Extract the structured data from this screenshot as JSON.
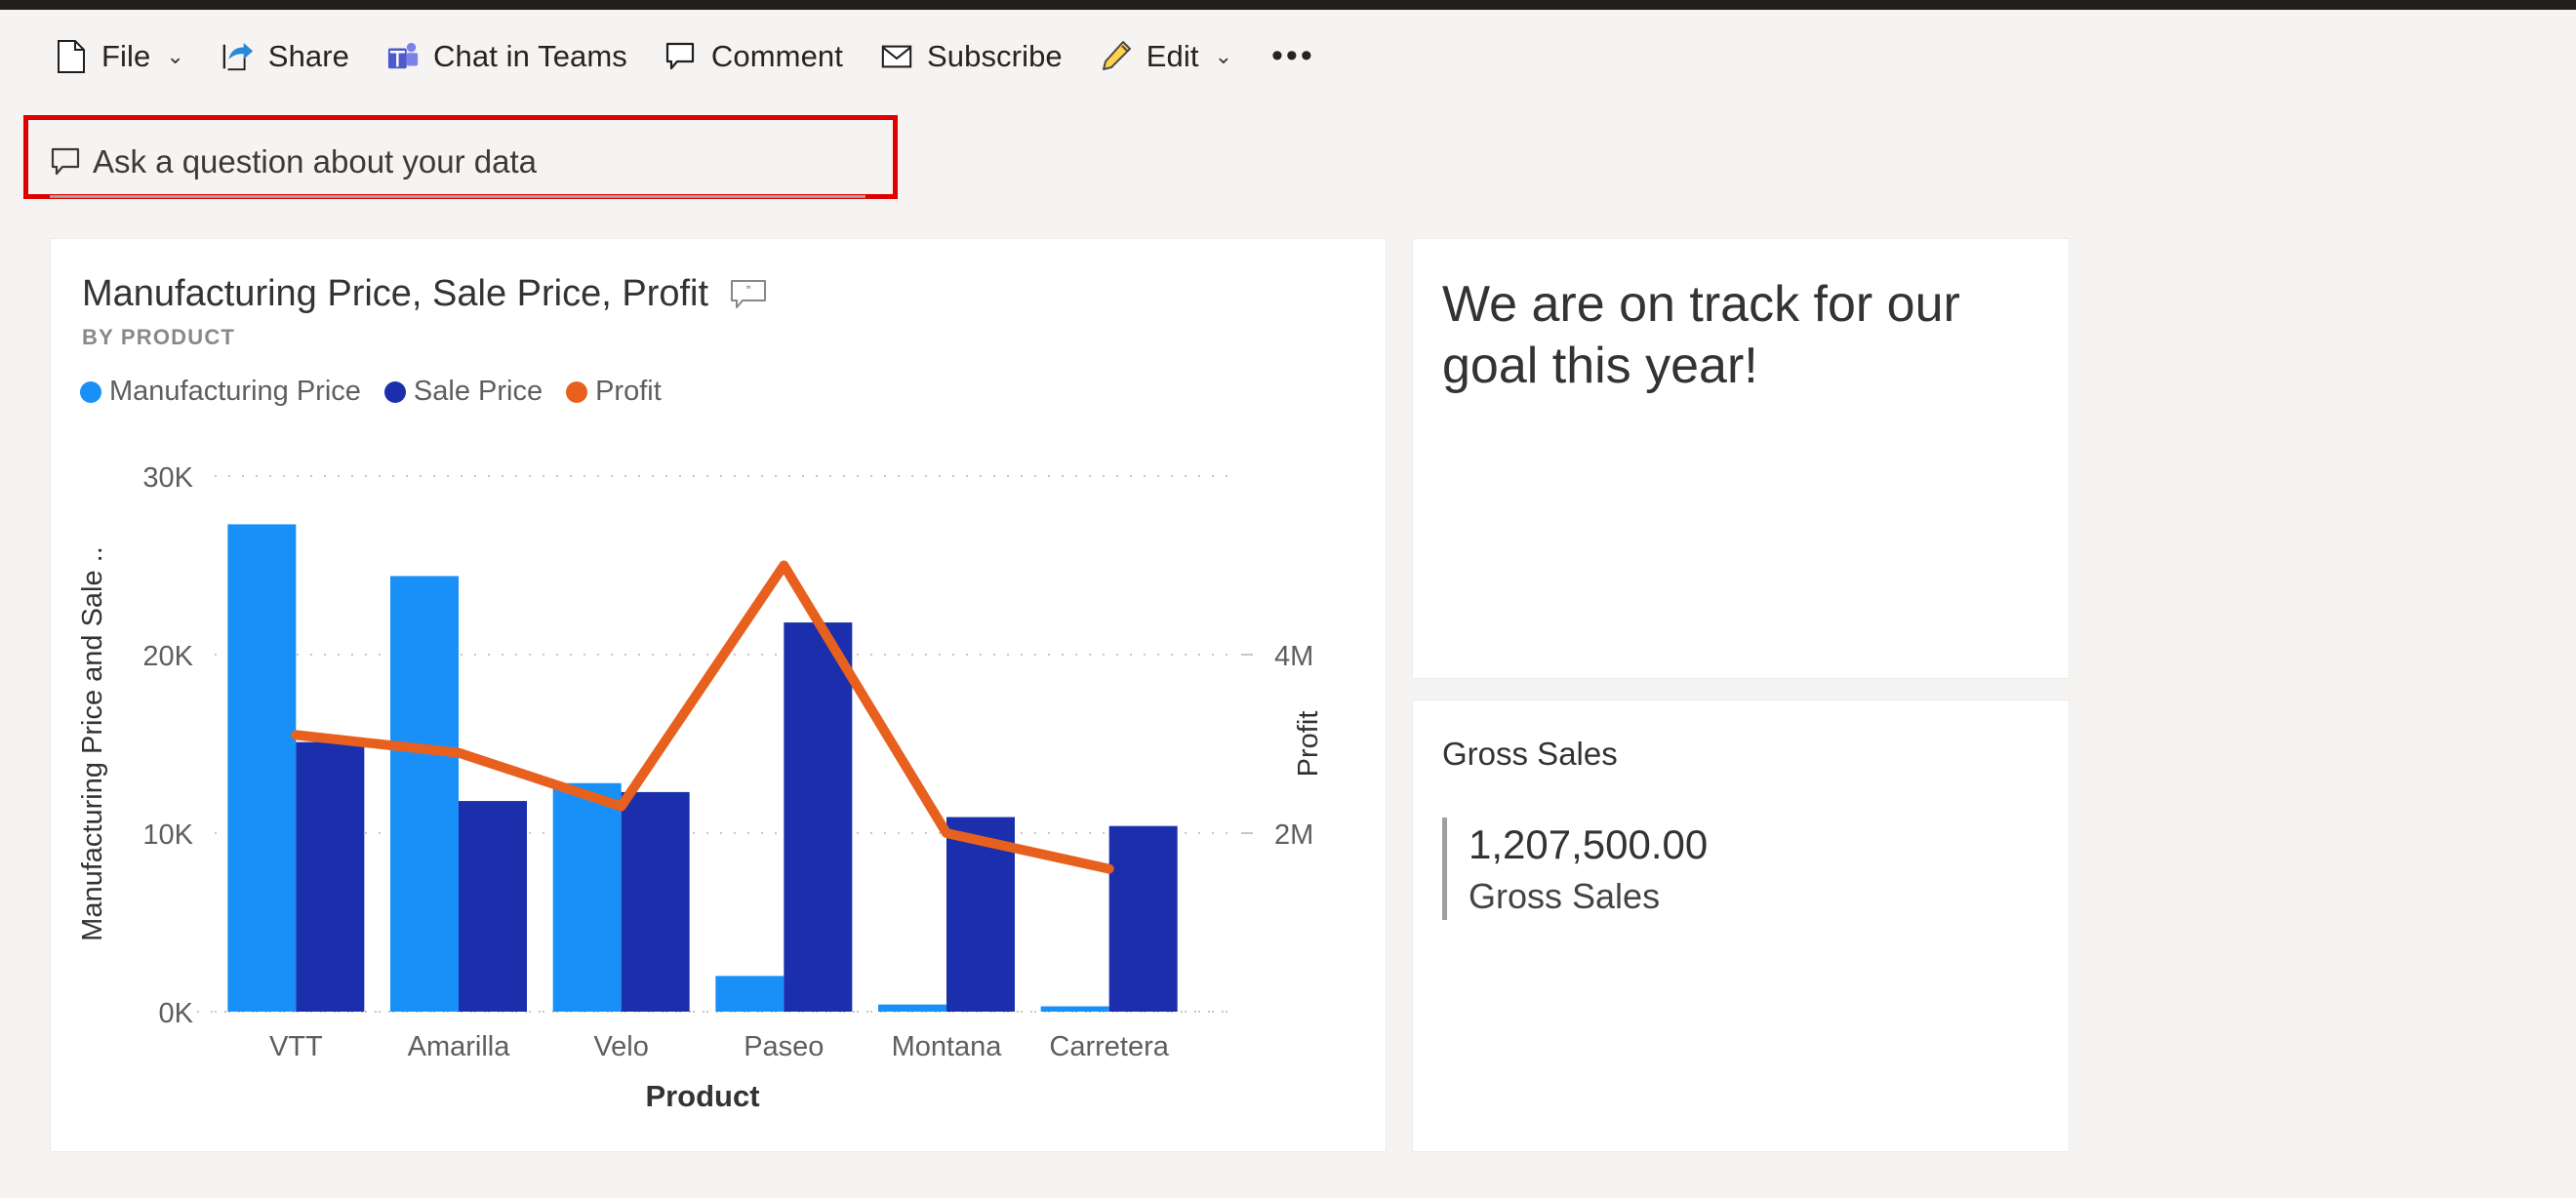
{
  "commandbar": {
    "items": [
      {
        "label": "File",
        "icon": "file-icon",
        "has_chevron": true
      },
      {
        "label": "Share",
        "icon": "share-icon",
        "has_chevron": false
      },
      {
        "label": "Chat in Teams",
        "icon": "teams-icon",
        "has_chevron": false
      },
      {
        "label": "Comment",
        "icon": "comment-icon",
        "has_chevron": false
      },
      {
        "label": "Subscribe",
        "icon": "mail-icon",
        "has_chevron": false
      },
      {
        "label": "Edit",
        "icon": "pencil-icon",
        "has_chevron": true
      }
    ],
    "overflow_label": "•••"
  },
  "qa": {
    "placeholder": "Ask a question about your data",
    "value": "",
    "icon": "qa-comment-icon",
    "highlight_color": "#e00000"
  },
  "chart_tile": {
    "title": "Manufacturing Price, Sale Price, Profit",
    "subtitle": "BY PRODUCT",
    "qa_badge_icon": "qa-badge-icon"
  },
  "text_tile": {
    "text": "We are on track for our goal this year!"
  },
  "card_tile": {
    "title": "Gross Sales",
    "value": "1,207,500.00",
    "label": "Gross Sales"
  },
  "chart_data": {
    "type": "bar",
    "title": "Manufacturing Price, Sale Price, Profit",
    "subtitle": "BY PRODUCT",
    "xlabel": "Product",
    "ylabel": "Manufacturing Price and Sale ..",
    "y2label": "Profit",
    "categories": [
      "VTT",
      "Amarilla",
      "Velo",
      "Paseo",
      "Montana",
      "Carretera"
    ],
    "series": [
      {
        "name": "Manufacturing Price",
        "type": "column",
        "axis": "left",
        "color": "#1890f8",
        "values": [
          27300,
          24400,
          12800,
          2000,
          400,
          300
        ]
      },
      {
        "name": "Sale Price",
        "type": "column",
        "axis": "left",
        "color": "#1b2fad",
        "values": [
          15100,
          11800,
          12300,
          21800,
          10900,
          10400
        ]
      },
      {
        "name": "Profit",
        "type": "line",
        "axis": "right",
        "color": "#e8601e",
        "values": [
          3100000,
          2900000,
          2300000,
          5000000,
          2000000,
          1600000
        ]
      }
    ],
    "ylim": [
      0,
      30000
    ],
    "yticks": [
      0,
      10000,
      20000,
      30000
    ],
    "ytick_labels": [
      "0K",
      "10K",
      "20K",
      "30K"
    ],
    "y2lim": [
      0,
      6000000
    ],
    "y2ticks": [
      2000000,
      4000000
    ],
    "y2tick_labels": [
      "2M",
      "4M"
    ],
    "grid": true,
    "legend_position": "top-left",
    "legend": [
      "Manufacturing Price",
      "Sale Price",
      "Profit"
    ]
  }
}
